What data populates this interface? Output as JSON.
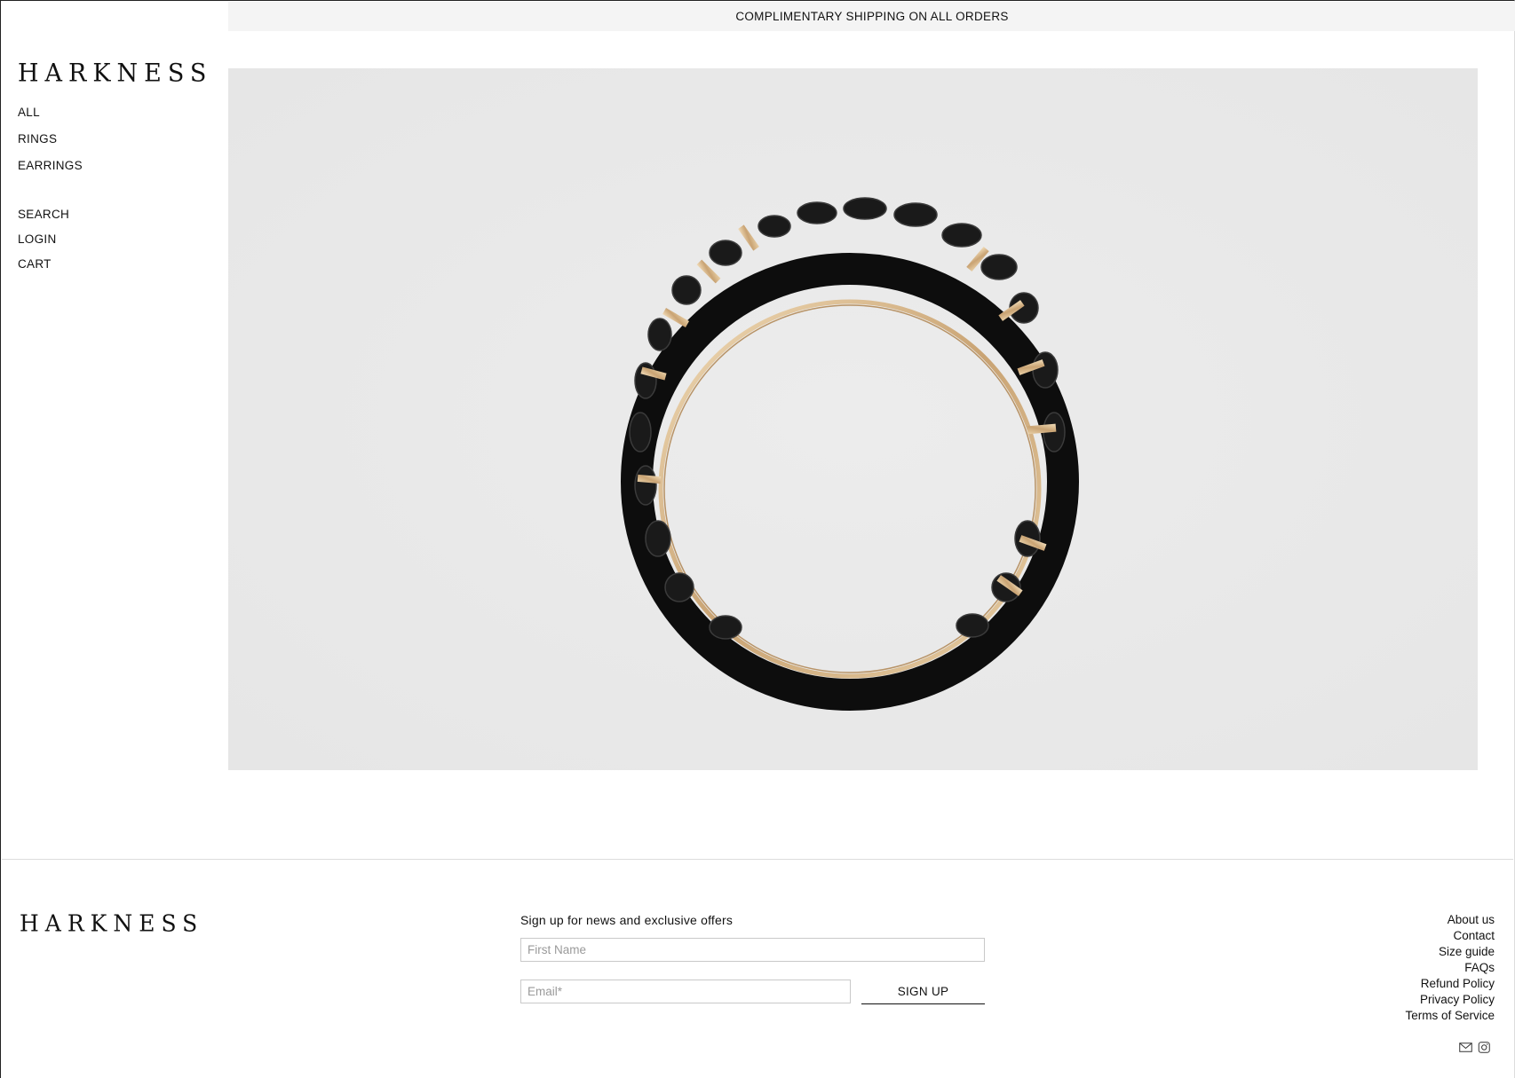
{
  "announcement": "COMPLIMENTARY SHIPPING ON ALL ORDERS",
  "brand": "HARKNESS",
  "nav": {
    "primary": [
      "ALL",
      "RINGS",
      "EARRINGS"
    ],
    "secondary": [
      "SEARCH",
      "LOGIN",
      "CART"
    ]
  },
  "hero": {
    "image": "diamond-eternity-ring-image",
    "background": "#e9e9e9"
  },
  "footer": {
    "signup_heading": "Sign up for news and exclusive offers",
    "first_name_placeholder": "First Name",
    "email_placeholder": "Email*",
    "signup_button": "SIGN UP",
    "links": [
      "About us",
      "Contact",
      "Size guide",
      "FAQs",
      "Refund Policy",
      "Privacy Policy",
      "Terms of Service"
    ],
    "social_icons": [
      "mail-icon",
      "instagram-icon"
    ]
  },
  "colors": {
    "text": "#111111",
    "announcement_bg": "#f4f4f4",
    "hero_bg": "#e9e9e9",
    "ring_gold": "#d9b98a"
  }
}
